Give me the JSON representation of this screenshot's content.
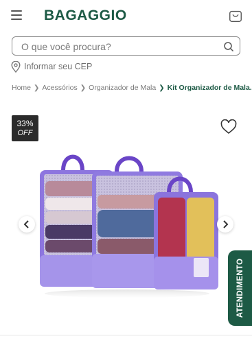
{
  "header": {
    "logo_text": "BAGAGGIO",
    "menu_icon": "hamburger-menu-icon",
    "cart_icon": "shopping-bag-icon"
  },
  "search": {
    "placeholder": "O que você procura?",
    "value": "",
    "icon": "search-icon"
  },
  "cep": {
    "icon": "location-pin-icon",
    "label": "Informar seu CEP"
  },
  "breadcrumb": {
    "items": [
      "Home",
      "Acessórios",
      "Organizador de Mala"
    ],
    "current": "Kit Organizador de Mala..."
  },
  "product": {
    "discount_percent": "33%",
    "discount_label": "OFF",
    "favorite_icon": "heart-outline-icon",
    "image_alt": "Kit organizador de mala roxo com três bolsas"
  },
  "carousel": {
    "prev_icon": "chevron-left-icon",
    "next_icon": "chevron-right-icon"
  },
  "support": {
    "label": "ATENDIMENTO"
  },
  "colors": {
    "brand_green": "#1d5a45",
    "bag_purple": "#8f7ae0",
    "badge_dark": "#2b2b2b"
  }
}
